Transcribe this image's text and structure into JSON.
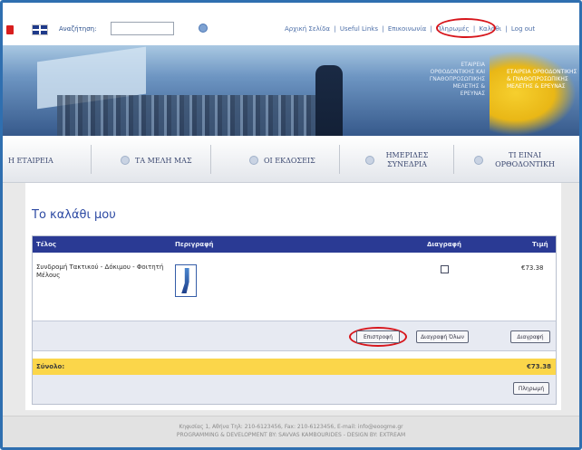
{
  "topbar": {
    "search_label": "Αναζήτηση:",
    "search_value": "",
    "links": [
      "Αρχική Σελίδα",
      "|",
      "Useful Links",
      "|",
      "Επικοινωνία",
      "|",
      "Πληρωμές",
      "|",
      "Καλάθι",
      "|",
      "Log out"
    ]
  },
  "banner": {
    "caption": "ΕΤΑΙΡΕΙΑ ΟΡΘΟΔΟΝΤΙΚΗΣ ΚΑΙ ΓΝΑΘΟΠΡΟΣΩΠΙΚΗΣ ΜΕΛΕΤΗΣ & ΕΡΕΥΝΑΣ",
    "logo_text": "ΕΤΑΙΡΕΙΑ ΟΡΘΟΔΟΝΤΙΚΗΣ & ΓΝΑΘΟΠΡΟΣΩΠΙΚΗΣ ΜΕΛΕΤΗΣ & ΕΡΕΥΝΑΣ"
  },
  "nav": {
    "items": [
      {
        "label": "Η ΕΤΑΙΡΕΙΑ"
      },
      {
        "label": "ΤΑ ΜΕΛΗ ΜΑΣ"
      },
      {
        "label": "ΟΙ ΕΚΔΟΣΕΙΣ"
      },
      {
        "label": "ΗΜΕΡΙΔΕΣ ΣΥΝΕΔΡΙΑ"
      },
      {
        "label": "ΤΙ ΕΙΝΑΙ ΟΡΘΟΔΟΝΤΙΚΗ"
      }
    ]
  },
  "page": {
    "title": "Το καλάθι μου"
  },
  "cart": {
    "headers": {
      "item": "Τέλος",
      "description": "Περιγραφή",
      "remove": "Διαγραφή",
      "price": "Τιμή"
    },
    "rows": [
      {
        "description": "Συνδρομή Τακτικού - Δόκιμου - Φοιτητή Μέλους",
        "price": "€73.38",
        "remove_checked": false
      }
    ],
    "buttons": {
      "update": "Επιστροφή",
      "remove_all": "Διαγραφή Όλων",
      "remove": "Διαγραφή",
      "pay": "Πληρωμή"
    },
    "total_label": "Σύνολο:",
    "total_value": "€73.38"
  },
  "footer": {
    "line1": "Κηφισίας 1, Αθήνα Τηλ: 210-6123456, Fax: 210-6123456, E-mail: info@eoogme.gr",
    "line2": "PROGRAMMING & DEVELOPMENT BY: SAVVAS KAMBOURIDES - DESIGN BY: EXTREAM"
  },
  "colors": {
    "frame": "#2f6fb0",
    "header_bar": "#2a3a94",
    "total_bar": "#fbd64a",
    "highlight": "#d7161c"
  }
}
